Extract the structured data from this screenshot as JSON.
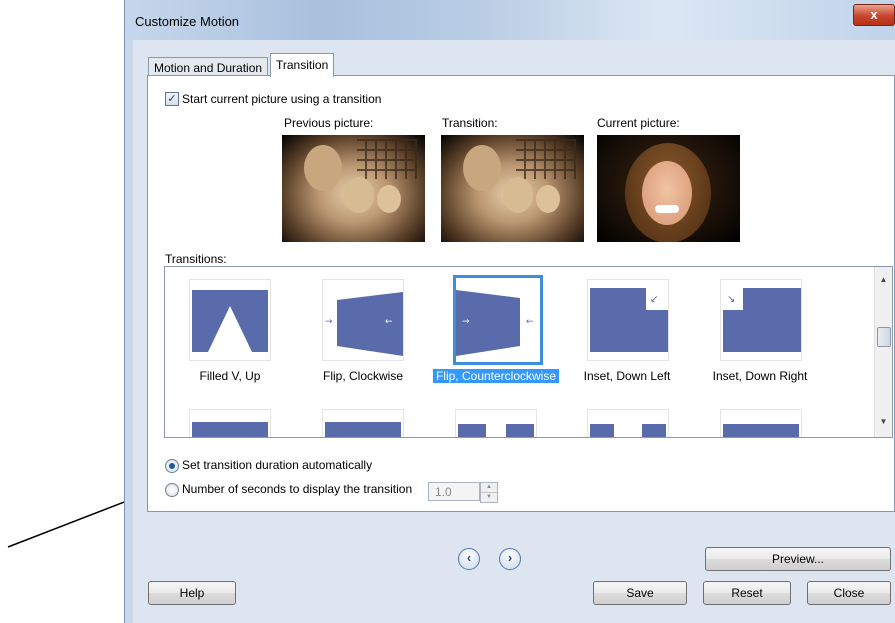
{
  "window": {
    "title": "Customize Motion",
    "close_glyph": "x"
  },
  "tabs": [
    {
      "label": "Motion and Duration",
      "active": false
    },
    {
      "label": "Transition",
      "active": true
    }
  ],
  "start_checkbox": {
    "label": "Start current picture using a transition",
    "checked": true
  },
  "previews": {
    "previous_label": "Previous picture:",
    "transition_label": "Transition:",
    "current_label": "Current picture:"
  },
  "transitions": {
    "label": "Transitions:",
    "items": [
      {
        "label": "Filled V, Up",
        "selected": false
      },
      {
        "label": "Flip, Clockwise",
        "selected": false
      },
      {
        "label": "Flip, Counterclockwise",
        "selected": true
      },
      {
        "label": "Inset, Down Left",
        "selected": false
      },
      {
        "label": "Inset, Down Right",
        "selected": false
      }
    ],
    "scroll_up_glyph": "▲",
    "scroll_down_glyph": "▼"
  },
  "duration": {
    "auto_label": "Set transition duration automatically",
    "auto_selected": true,
    "seconds_label": "Number of seconds to display the transition",
    "seconds_value": "1.0"
  },
  "nav": {
    "prev_glyph": "‹",
    "next_glyph": "›"
  },
  "buttons": {
    "preview": "Preview...",
    "help": "Help",
    "save": "Save",
    "reset": "Reset",
    "close": "Close"
  },
  "icons": {
    "close": "close-icon",
    "prev": "chevron-left-icon",
    "next": "chevron-right-icon"
  },
  "colors": {
    "selection": "#3399ff",
    "thumbnail_shape": "#5a6bab",
    "window_frame": "#dde5f0"
  }
}
